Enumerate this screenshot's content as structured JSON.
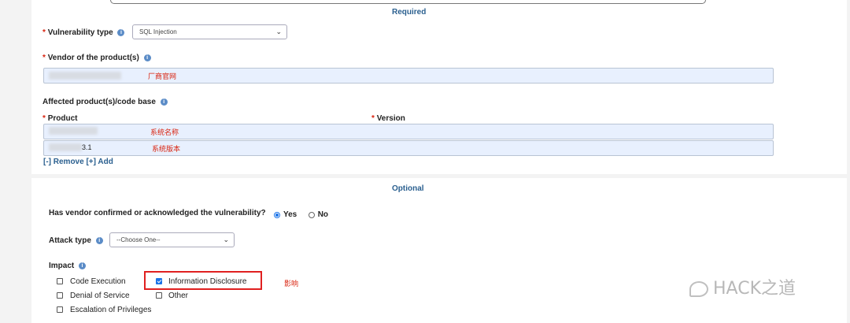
{
  "required": {
    "title": "Required",
    "vuln_type_label": "Vulnerability type",
    "vuln_type_value": "SQL Injection",
    "vendor_label": "Vendor of the product(s)",
    "vendor_note": "厂商官网",
    "affected_label": "Affected product(s)/code base",
    "product_label": "Product",
    "version_label": "Version",
    "product_note": "系统名称",
    "version_partial": "3.1",
    "version_note": "系统版本",
    "remove_add": "[-] Remove [+] Add"
  },
  "optional": {
    "title": "Optional",
    "confirmed_question": "Has vendor confirmed or acknowledged the vulnerability?",
    "yes_label": "Yes",
    "no_label": "No",
    "attack_type_label": "Attack type",
    "attack_type_value": "--Choose One--",
    "impact_label": "Impact",
    "impacts": {
      "code_execution": "Code Execution",
      "info_disclosure": "Information Disclosure",
      "dos": "Denial of Service",
      "other": "Other",
      "escalation": "Escalation of Privileges"
    },
    "impact_note": "影响"
  },
  "watermark": "HACK之道",
  "req_star": "*",
  "info_glyph": "i",
  "chevron": "⌄",
  "colors": {
    "accent": "#2a5f8f",
    "required_star": "#d9230f",
    "input_fill": "#e8f0fe",
    "annotation": "#e02020"
  }
}
